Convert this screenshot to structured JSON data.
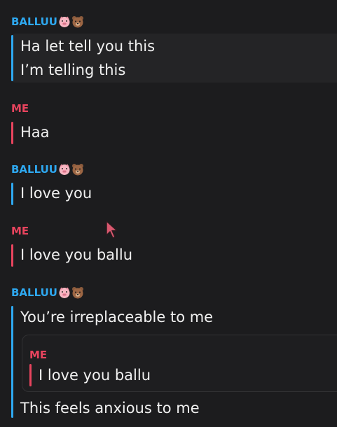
{
  "messages": [
    {
      "sender": "BALLUU",
      "lines": [
        "Ha let tell you this",
        "I’m telling this"
      ]
    },
    {
      "sender": "ME",
      "lines": [
        "Haa"
      ]
    },
    {
      "sender": "BALLUU",
      "lines": [
        "I love you"
      ]
    },
    {
      "sender": "ME",
      "lines": [
        "I love you ballu"
      ]
    },
    {
      "sender": "BALLUU",
      "lines": [
        "You’re irreplaceable to me"
      ],
      "quoted": {
        "sender": "ME",
        "text": "I love you ballu"
      },
      "after_quote": "This feels anxious to me"
    }
  ],
  "sender_emojis": [
    "pig-face-icon",
    "bear-face-icon"
  ],
  "colors": {
    "background": "#1c1c1e",
    "them": "#2ea8f0",
    "me": "#e8445e",
    "text": "#f0f0f0"
  }
}
